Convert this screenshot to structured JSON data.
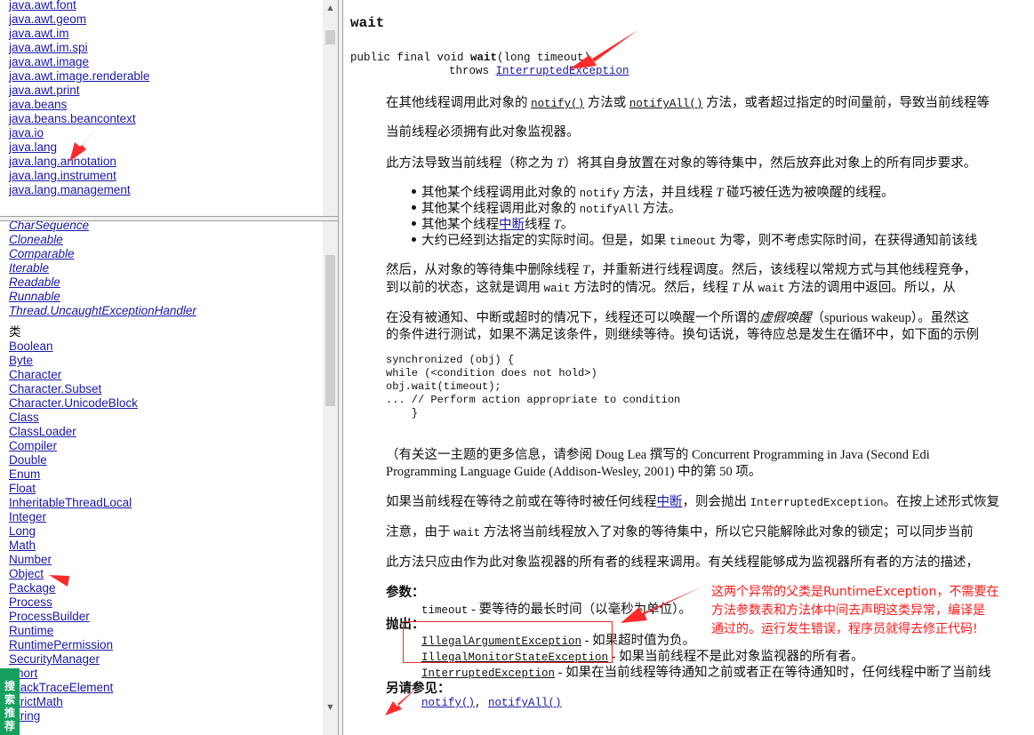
{
  "packages": [
    "java.awt.font",
    "java.awt.geom",
    "java.awt.im",
    "java.awt.im.spi",
    "java.awt.image",
    "java.awt.image.renderable",
    "java.awt.print",
    "java.beans",
    "java.beans.beancontext",
    "java.io",
    "java.lang",
    "java.lang.annotation",
    "java.lang.instrument",
    "java.lang.management"
  ],
  "interfaces": [
    "CharSequence",
    "Cloneable",
    "Comparable",
    "Iterable",
    "Readable",
    "Runnable",
    "Thread.UncaughtExceptionHandler"
  ],
  "classes_heading": "类",
  "classes": [
    "Boolean",
    "Byte",
    "Character",
    "Character.Subset",
    "Character.UnicodeBlock",
    "Class",
    "ClassLoader",
    "Compiler",
    "Double",
    "Enum",
    "Float",
    "InheritableThreadLocal",
    "Integer",
    "Long",
    "Math",
    "Number",
    "Object",
    "Package",
    "Process",
    "ProcessBuilder",
    "Runtime",
    "RuntimePermission",
    "SecurityManager",
    "Short",
    "StackTraceElement",
    "StrictMath",
    "String"
  ],
  "search_tab": "搜索推荐",
  "doc": {
    "title": "wait",
    "signature": {
      "prefix": "public final void ",
      "method": "wait",
      "params": "(long timeout)",
      "throws": "throws ",
      "exception": "InterruptedException"
    },
    "p1": {
      "a": "在其他线程调用此对象的 ",
      "b": "notify()",
      "c": " 方法或 ",
      "d": "notifyAll()",
      "e": " 方法，或者超过指定的时间量前，导致当前线程等"
    },
    "p2": "当前线程必须拥有此对象监视器。",
    "p3": {
      "a": "此方法导致当前线程（称之为 ",
      "b": "T",
      "c": "）将其自身放置在对象的等待集中，然后放弃此对象上的所有同步要求。"
    },
    "bullets": {
      "b1": {
        "a": "其他某个线程调用此对象的 ",
        "b": "notify",
        "c": " 方法，并且线程 ",
        "d": "T",
        "e": " 碰巧被任选为被唤醒的线程。"
      },
      "b2": {
        "a": "其他某个线程调用此对象的 ",
        "b": "notifyAll",
        "c": " 方法。"
      },
      "b3": {
        "a": "其他某个线程",
        "b": "中断",
        "c": "线程 ",
        "d": "T",
        "e": "。"
      },
      "b4": {
        "a": "大约已经到达指定的实际时间。但是，如果 ",
        "b": "timeout",
        "c": " 为零，则不考虑实际时间，在获得通知前该线"
      }
    },
    "p4": {
      "l1a": "然后，从对象的等待集中删除线程 ",
      "l1b": "T",
      "l1c": "，并重新进行线程调度。然后，该线程以常规方式与其他线程竞争，",
      "l2a": "到以前的状态，这就是调用 ",
      "l2b": "wait",
      "l2c": " 方法时的情况。然后，线程 ",
      "l2d": "T",
      "l2e": " 从 ",
      "l2f": "wait",
      "l2g": " 方法的调用中返回。所以，从 "
    },
    "p5": {
      "l1a": "在没有被通知、中断或超时的情况下，线程还可以唤醒一个所谓的",
      "l1b": "虚假唤醒",
      "l1c": "（spurious wakeup）。虽然这",
      "l2": "的条件进行测试，如果不满足该条件，则继续等待。换句话说，等待应总是发生在循环中，如下面的示例"
    },
    "code": [
      "synchronized (obj) {",
      "while (<condition does not hold>)",
      "obj.wait(timeout);",
      "... // Perform action appropriate to condition",
      "    }"
    ],
    "p6": {
      "l1": "（有关这一主题的更多信息，请参阅 Doug Lea 撰写的 Concurrent Programming in Java (Second Edi",
      "l2": "Programming Language Guide (Addison-Wesley, 2001) 中的第 50 项。"
    },
    "p7": {
      "a": "如果当前线程在等待之前或在等待时被任何线程",
      "b": "中断",
      "c": "，则会抛出 ",
      "d": "InterruptedException",
      "e": "。在按上述形式恢复"
    },
    "p8": {
      "a": "注意，由于 ",
      "b": "wait",
      "c": " 方法将当前线程放入了对象的等待集中，所以它只能解除此对象的锁定；可以同步当前"
    },
    "p9": "此方法只应由作为此对象监视器的所有者的线程来调用。有关线程能够成为监视器所有者的方法的描述，",
    "params_label": "参数：",
    "param1": {
      "name": "timeout",
      "desc": " - 要等待的最长时间（以毫秒为单位）。"
    },
    "throws_label": "抛出：",
    "ex1": {
      "name": "IllegalArgumentException",
      "desc": " - 如果超时值为负。"
    },
    "ex2": {
      "name": "IllegalMonitorStateException",
      "desc": " - 如果当前线程不是此对象监视器的所有者。"
    },
    "ex3": {
      "name": "InterruptedException",
      "desc": " - 如果在当前线程等待通知之前或者正在等待通知时，任何线程中断了当前线"
    },
    "see_label": "另请参见：",
    "see1": "notify()",
    "see_sep": ", ",
    "see2": "notifyAll()"
  },
  "annotation": {
    "line1": "这两个异常的父类是RuntimeException，不需要在",
    "line2": "方法参数表和方法体中间去声明这类异常，编译是",
    "line3": "通过的。运行发生错误，程序员就得去修正代码!"
  },
  "colors": {
    "link": "#1a1aa6",
    "annotation": "#ff1a1a",
    "search_tab": "#17a05d"
  }
}
